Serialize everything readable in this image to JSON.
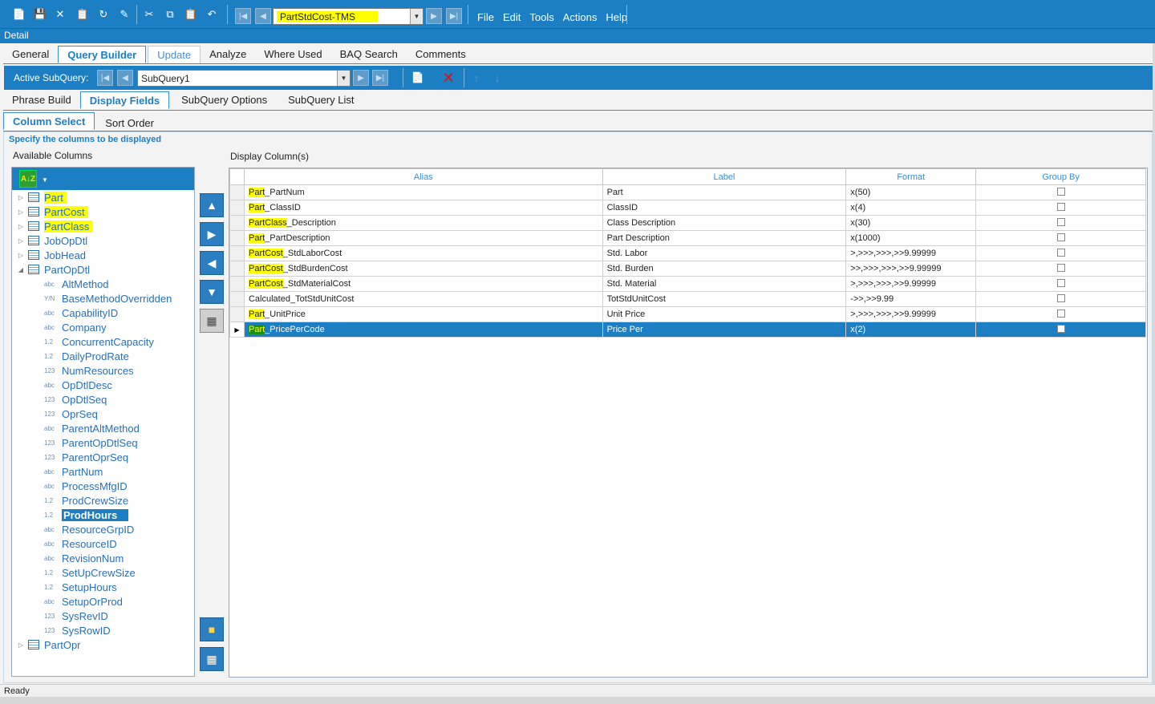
{
  "toolbar": {
    "query_name": "PartStdCost-TMS",
    "menu": [
      "File",
      "Edit",
      "Tools",
      "Actions",
      "Help"
    ]
  },
  "detail_label": "Detail",
  "main_tabs": [
    "General",
    "Query Builder",
    "Update",
    "Analyze",
    "Where Used",
    "BAQ Search",
    "Comments"
  ],
  "subquery_bar": {
    "label": "Active SubQuery:",
    "value": "SubQuery1"
  },
  "sub_tabs": [
    "Phrase Build",
    "Display Fields",
    "SubQuery Options",
    "SubQuery List"
  ],
  "inner_tabs": [
    "Column Select",
    "Sort Order"
  ],
  "hint": "Specify the columns to be displayed",
  "available_label": "Available Columns",
  "display_label": "Display Column(s)",
  "tree": {
    "tables": [
      "Part",
      "PartCost",
      "PartClass",
      "JobOpDtl",
      "JobHead",
      "PartOpDtl"
    ],
    "columns": [
      {
        "type": "abc",
        "name": "AltMethod"
      },
      {
        "type": "Y/N",
        "name": "BaseMethodOverridden"
      },
      {
        "type": "abc",
        "name": "CapabilityID"
      },
      {
        "type": "abc",
        "name": "Company"
      },
      {
        "type": "1.2",
        "name": "ConcurrentCapacity"
      },
      {
        "type": "1.2",
        "name": "DailyProdRate"
      },
      {
        "type": "123",
        "name": "NumResources"
      },
      {
        "type": "abc",
        "name": "OpDtlDesc"
      },
      {
        "type": "123",
        "name": "OpDtlSeq"
      },
      {
        "type": "123",
        "name": "OprSeq"
      },
      {
        "type": "abc",
        "name": "ParentAltMethod"
      },
      {
        "type": "123",
        "name": "ParentOpDtlSeq"
      },
      {
        "type": "123",
        "name": "ParentOprSeq"
      },
      {
        "type": "abc",
        "name": "PartNum"
      },
      {
        "type": "abc",
        "name": "ProcessMfgID"
      },
      {
        "type": "1.2",
        "name": "ProdCrewSize"
      },
      {
        "type": "1.2",
        "name": "ProdHours"
      },
      {
        "type": "abc",
        "name": "ResourceGrpID"
      },
      {
        "type": "abc",
        "name": "ResourceID"
      },
      {
        "type": "abc",
        "name": "RevisionNum"
      },
      {
        "type": "1.2",
        "name": "SetUpCrewSize"
      },
      {
        "type": "1.2",
        "name": "SetupHours"
      },
      {
        "type": "abc",
        "name": "SetupOrProd"
      },
      {
        "type": "123",
        "name": "SysRevID"
      },
      {
        "type": "123",
        "name": "SysRowID"
      }
    ],
    "last_table": "PartOpr"
  },
  "grid": {
    "headers": [
      "Alias",
      "Label",
      "Format",
      "Group By"
    ],
    "rows": [
      {
        "hl": "Part",
        "rest": "_PartNum",
        "label": "Part",
        "format": "x(50)"
      },
      {
        "hl": "Part",
        "rest": "_ClassID",
        "label": "ClassID",
        "format": "x(4)"
      },
      {
        "hl": "PartClass",
        "rest": "_Description",
        "label": "Class Description",
        "format": "x(30)"
      },
      {
        "hl": "Part",
        "rest": "_PartDescription",
        "label": "Part Description",
        "format": "x(1000)"
      },
      {
        "hl": "PartCost",
        "rest": "_StdLaborCost",
        "label": "Std. Labor",
        "format": ">,>>>,>>>,>>9.99999"
      },
      {
        "hl": "PartCost",
        "rest": "_StdBurdenCost",
        "label": "Std. Burden",
        "format": ">>,>>>,>>>,>>9.99999"
      },
      {
        "hl": "PartCost",
        "rest": "_StdMaterialCost",
        "label": "Std. Material",
        "format": ">,>>>,>>>,>>9.99999"
      },
      {
        "hl": "",
        "rest": "Calculated_TotStdUnitCost",
        "label": "TotStdUnitCost",
        "format": "->>,>>9.99"
      },
      {
        "hl": "Part",
        "rest": "_UnitPrice",
        "label": "Unit Price",
        "format": ">,>>>,>>>,>>9.99999"
      },
      {
        "hl": "Part",
        "rest": "_PricePerCode",
        "label": "Price Per",
        "format": "x(2)"
      }
    ]
  },
  "status": "Ready",
  "colors": {
    "accent": "#1c7fc3",
    "highlight": "#ffff00"
  }
}
